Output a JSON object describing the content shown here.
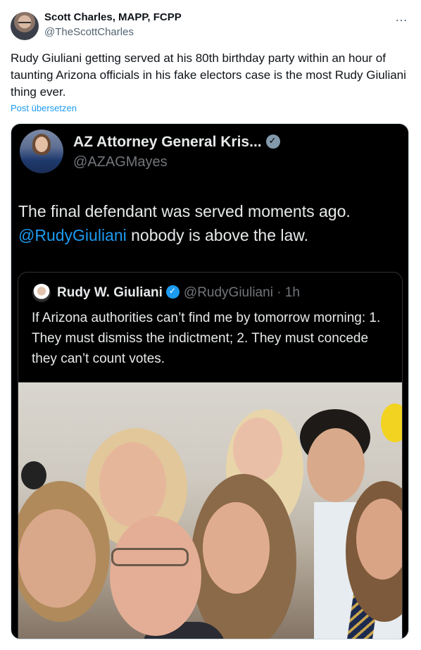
{
  "author": {
    "name": "Scott Charles, MAPP, FCPP",
    "handle": "@TheScottCharles"
  },
  "more_icon": "…",
  "tweet": {
    "text": "Rudy Giuliani getting served at his 80th birthday party within an hour of taunting Arizona officials in his fake electors case is the most Rudy Giuliani thing ever.",
    "translate_label": "Post übersetzen"
  },
  "embedded": {
    "name": "AZ Attorney General Kris...",
    "handle": "@AZAGMayes",
    "text_part1": "The final defendant was served moments ago.",
    "mention": "@RudyGiuliani",
    "text_part2": "nobody is above the law.",
    "quote": {
      "name": "Rudy W. Giuliani",
      "handle": "@RudyGiuliani · 1h",
      "text": "If Arizona authorities can’t find me by tomorrow morning: 1. They must dismiss the indictment; 2. They must concede they can’t count votes."
    }
  },
  "colors": {
    "link": "#1d9bf0",
    "text": "#0f1419",
    "muted": "#536471",
    "dark_bg": "#000000"
  }
}
